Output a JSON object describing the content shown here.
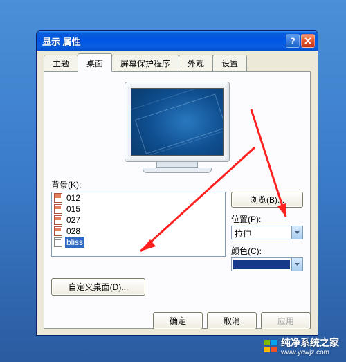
{
  "dialog": {
    "title": "显示 属性"
  },
  "tabs": {
    "theme": "主题",
    "desktop": "桌面",
    "screensaver": "屏幕保护程序",
    "appearance": "外观",
    "settings": "设置"
  },
  "background": {
    "label": "背景(K):",
    "items": [
      {
        "name": "012",
        "type": "image"
      },
      {
        "name": "015",
        "type": "image"
      },
      {
        "name": "027",
        "type": "image"
      },
      {
        "name": "028",
        "type": "image"
      },
      {
        "name": "bliss",
        "type": "text",
        "selected": true
      }
    ],
    "browse": "浏览(B)...",
    "position_label": "位置(P):",
    "position_value": "拉伸",
    "color_label": "颜色(C):",
    "color_value": "#153a88"
  },
  "custom_desktop": "自定义桌面(D)...",
  "buttons": {
    "ok": "确定",
    "cancel": "取消",
    "apply": "应用"
  },
  "watermark": {
    "brand": "纯净系统之家",
    "url": "www.ycwjz.com"
  }
}
